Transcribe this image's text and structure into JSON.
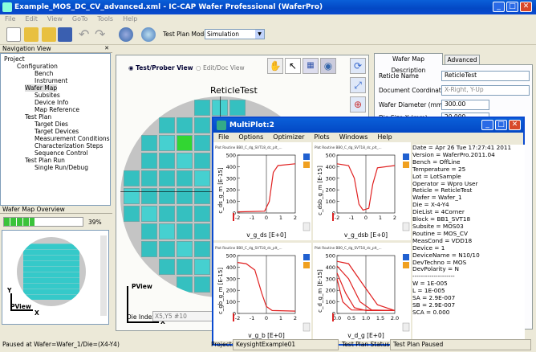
{
  "window": {
    "title": "Example_MOS_DC_CV_advanced.xml - IC-CAP Wafer Professional (WaferPro)",
    "min": "_",
    "max": "□",
    "close": "✕"
  },
  "menu": [
    "File",
    "Edit",
    "View",
    "GoTo",
    "Tools",
    "Help"
  ],
  "toolbar": {
    "plan_mode_label": "Test Plan Mode:",
    "plan_mode_value": "Simulation"
  },
  "nav": {
    "title": "Navigation View",
    "items": [
      "Project",
      "Configuration",
      "Bench",
      "Instrument",
      "Wafer Map",
      "Subsites",
      "Device Info",
      "Map Reference",
      "Test Plan",
      "Target Dies",
      "Target Devices",
      "Measurement Conditions",
      "Characterization Steps",
      "Sequence Control",
      "Test Plan Run",
      "Single Run/Debug"
    ]
  },
  "overview": {
    "title": "Wafer Map Overview",
    "progress": "39%",
    "progress_value": 0.39,
    "x_label": "X",
    "y_label": "Y",
    "pview": "PView"
  },
  "main": {
    "view_test": "Test/Prober View",
    "view_edit": "Edit/Doc View",
    "reticle_title": "ReticleTest",
    "die_index_label": "Die Index:",
    "die_index_value": "X5,Y5 #10",
    "pview": "PView",
    "x_label": "X"
  },
  "props": {
    "tab1": "Wafer Map Description",
    "tab2": "Advanced",
    "rows": [
      {
        "label": "Reticle Name",
        "value": "ReticleTest"
      },
      {
        "label": "Document Coordinates",
        "value": "X-Right, Y-Up"
      },
      {
        "label": "Wafer Diameter (mm)",
        "value": "300.00"
      },
      {
        "label": "Die Size X (mm)",
        "value": "20.000"
      }
    ]
  },
  "multiplot": {
    "title": "MultiPlot:2",
    "menu": [
      "File",
      "Options",
      "Optimizer",
      "Plots",
      "Windows",
      "Help"
    ],
    "panels": [
      {
        "caption": "Plot Routine BB0_C_dg_SVT18_dc_plt_...",
        "ylabel": "c_ds_g_m  [E-15]",
        "xlabel": "v_g_ds  [E+0]",
        "yticks": [
          "500",
          "400",
          "300",
          "200",
          "100",
          "0"
        ],
        "xticks": [
          "-2",
          "-1",
          "0",
          "1",
          "2"
        ]
      },
      {
        "caption": "Plot Routine BB0_C_dg_SVT18_dc_plt_...",
        "ylabel": "c_dsb_g_m  [E-15]",
        "xlabel": "v_g_dsb  [E+0]",
        "yticks": [
          "500",
          "400",
          "300",
          "200",
          "100",
          "0"
        ],
        "xticks": [
          "-2",
          "-1",
          "0",
          "1",
          "2"
        ]
      },
      {
        "caption": "Plot Routine BB0_C_dg_SVT18_dc_plt_...",
        "ylabel": "c_gb_g_m  [E-15]",
        "xlabel": "v_g_b  [E+0]",
        "yticks": [
          "500",
          "400",
          "300",
          "200",
          "100",
          "0"
        ],
        "xticks": [
          "-2",
          "-1",
          "0",
          "1",
          "2"
        ]
      },
      {
        "caption": "Plot Routine BB0_C_dg_SVT18_dc_plt_...",
        "ylabel": "c_d_g_m  [E-15]",
        "xlabel": "v_d_g  [E+0]",
        "yticks": [
          "500",
          "400",
          "300",
          "200",
          "100",
          "0"
        ],
        "xticks": [
          "0.0",
          "0.5",
          "1.0",
          "1.5",
          "2.0"
        ]
      }
    ],
    "info": "Date = Apr 26 Tue 17:27:41 2011\nVersion = WaferPro.2011.04\nBench = OffLine\nTemperature = 25\nLot = LotSample\nOperator = Wpro User\nReticle = ReticleTest\nWafer = Wafer_1\nDie = X-4-Y4\nDieList = 4Corner\nBlock = BB1_SVT18\nSubsite = MOS03\nRoutine = MOS_CV\nMeasCond = VDD18\nDevice = 1\nDeviceName = N10/10\nDevTechno = MOS\nDevPolarity = N\n--------------------\nW = 1E-005\nL = 1E-005\nSA = 2.9E-007\nSB = 2.9E-007\nSCA = 0.000"
  },
  "status": {
    "left": "Paused at Wafer=Wafer_1/Die=(X4-Y4)",
    "project_label": "Project:",
    "project_value": "KeysightExample01",
    "plan_status_label": "Test Plan Status:",
    "plan_status_value": "Test Plan Paused"
  },
  "colors": {
    "accent": "#0a4ad0",
    "die": "#35c9c9",
    "curve": "#e02020"
  }
}
